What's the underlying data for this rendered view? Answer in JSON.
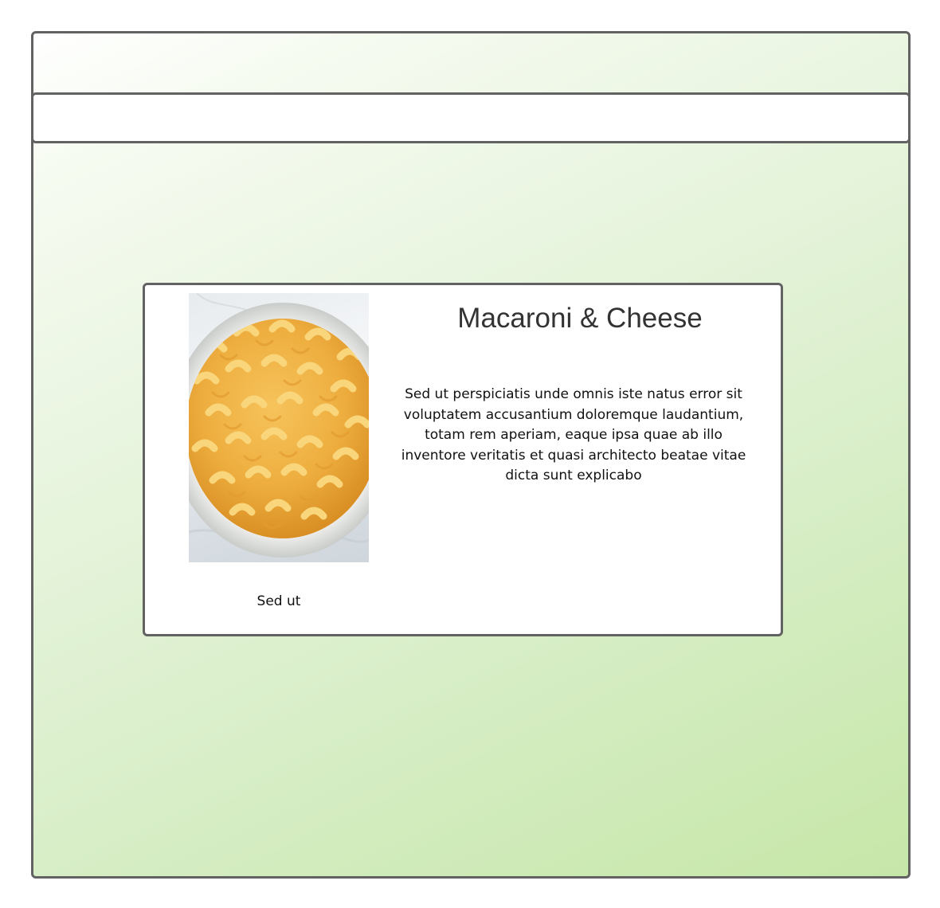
{
  "card": {
    "title": "Macaroni & Cheese",
    "description": "Sed ut perspiciatis unde omnis iste natus error sit voluptatem accusantium doloremque laudantium, totam rem aperiam, eaque ipsa quae ab illo inventore veritatis et quasi architecto beatae vitae dicta sunt explicabo",
    "image_caption": "Sed ut",
    "image_subject": "macaroni-and-cheese-bowl"
  },
  "colors": {
    "border": "#626262",
    "background_gradient_start": "#ffffff",
    "background_gradient_end": "#c6e7a8",
    "title_text": "#333333",
    "body_text": "#111111"
  }
}
